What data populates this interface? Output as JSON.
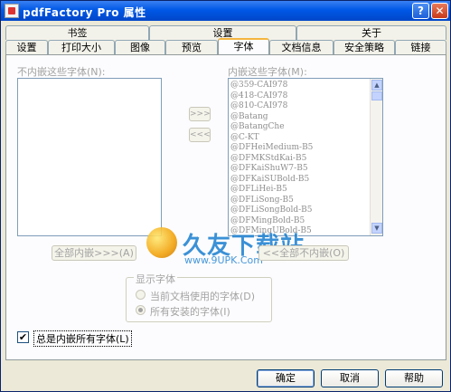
{
  "window": {
    "title": "pdfFactory Pro 属性"
  },
  "tabs_row1": [
    {
      "label": "书签"
    },
    {
      "label": "设置"
    },
    {
      "label": "关于"
    }
  ],
  "tabs_row2": [
    {
      "label": "设置"
    },
    {
      "label": "打印大小"
    },
    {
      "label": "图像"
    },
    {
      "label": "预览"
    },
    {
      "label": "字体",
      "active": true
    },
    {
      "label": "文档信息"
    },
    {
      "label": "安全策略"
    },
    {
      "label": "链接"
    }
  ],
  "fonts": {
    "not_embed_label": "不内嵌这些字体(N):",
    "embed_label": "内嵌这些字体(M):",
    "embed_list": [
      "@359-CAI978",
      "@418-CAI978",
      "@810-CAI978",
      "@Batang",
      "@BatangChe",
      "@C-KT",
      "@DFHeiMedium-B5",
      "@DFMKStdKai-B5",
      "@DFKaiShuW7-B5",
      "@DFKaiSUBold-B5",
      "@DFLiHei-B5",
      "@DFLiSong-B5",
      "@DFLiSongBold-B5",
      "@DFMingBold-B5",
      "@DFMingUBold-B5"
    ],
    "add_label": ">>>",
    "remove_label": "<<<",
    "embed_all_label": "全部内嵌>>>(A)",
    "embed_none_label": "<<全部不内嵌(O)"
  },
  "display_fonts": {
    "title": "显示字体",
    "option_current": "当前文档使用的字体(D)",
    "option_all": "所有安装的字体(I)",
    "selected": "all"
  },
  "always_embed": {
    "label": "总是内嵌所有字体(L)",
    "checked": true
  },
  "watermark": {
    "text": "久友下载站",
    "url": "www.9UPK.Com"
  },
  "buttons": {
    "ok": "确定",
    "cancel": "取消",
    "help": "帮助"
  }
}
